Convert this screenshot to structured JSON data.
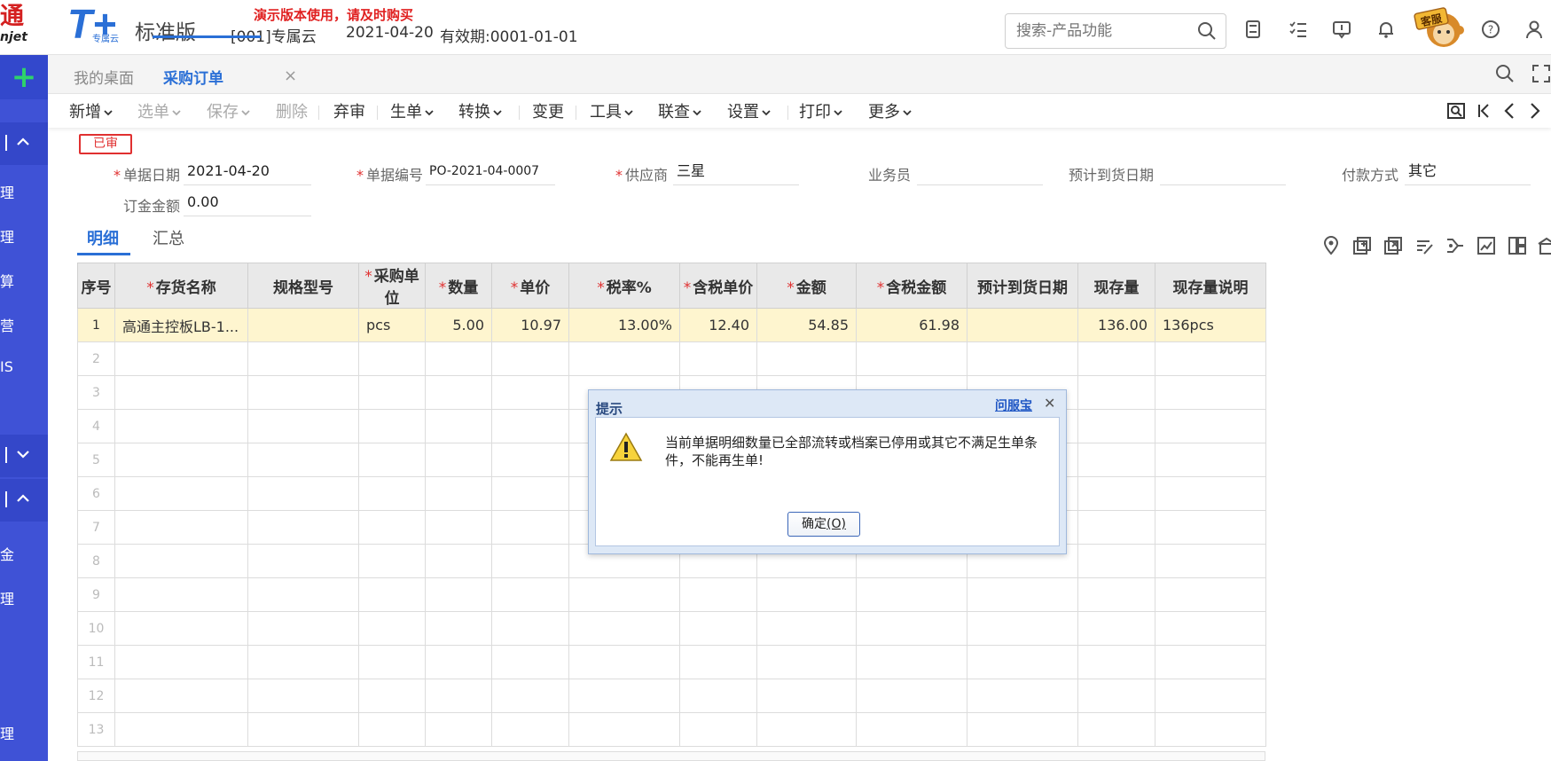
{
  "header": {
    "brand_left_line1": "通",
    "brand_left_line2": "njet",
    "logo_text": "T+",
    "logo_sub": "专属云",
    "edition": "标准版",
    "demo_notice": "演示版本使用，请及时购买",
    "account": "[001]专属云",
    "system_date": "2021-04-20",
    "validity": "有效期:0001-01-01",
    "search_placeholder": "搜索-产品功能",
    "kefu_label": "客服"
  },
  "sidebar": {
    "add_label": "+",
    "items": [
      "理",
      "理",
      "算",
      "营",
      "IS",
      "金",
      "理",
      "理"
    ]
  },
  "tabs": [
    {
      "label": "我的桌面",
      "active": false
    },
    {
      "label": "采购订单",
      "active": true
    }
  ],
  "toolbar": {
    "buttons": [
      {
        "label": "新增",
        "dropdown": true,
        "disabled": false
      },
      {
        "label": "选单",
        "dropdown": true,
        "disabled": true
      },
      {
        "label": "保存",
        "dropdown": true,
        "disabled": true
      },
      {
        "label": "删除",
        "dropdown": false,
        "disabled": true
      },
      {
        "label": "弃审",
        "dropdown": false,
        "disabled": false
      },
      {
        "label": "生单",
        "dropdown": true,
        "disabled": false
      },
      {
        "label": "转换",
        "dropdown": true,
        "disabled": false
      },
      {
        "label": "变更",
        "dropdown": false,
        "disabled": false
      },
      {
        "label": "工具",
        "dropdown": true,
        "disabled": false
      },
      {
        "label": "联查",
        "dropdown": true,
        "disabled": false
      },
      {
        "label": "设置",
        "dropdown": true,
        "disabled": false
      },
      {
        "label": "打印",
        "dropdown": true,
        "disabled": false
      },
      {
        "label": "更多",
        "dropdown": true,
        "disabled": false
      }
    ]
  },
  "status": "已审",
  "form": {
    "doc_date_label": "单据日期",
    "doc_date": "2021-04-20",
    "doc_no_label": "单据编号",
    "doc_no": "PO-2021-04-0007",
    "supplier_label": "供应商",
    "supplier": "三星",
    "salesman_label": "业务员",
    "salesman": "",
    "eta_label": "预计到货日期",
    "eta": "",
    "payment_label": "付款方式",
    "payment": "其它",
    "amount_label": "订金金额",
    "amount": "0.00"
  },
  "detail_tabs": [
    "明细",
    "汇总"
  ],
  "grid": {
    "headers": [
      "序号",
      "存货名称",
      "规格型号",
      "采购单位",
      "数量",
      "单价",
      "税率%",
      "含税单价",
      "金额",
      "含税金额",
      "预计到货日期",
      "现存量",
      "现存量说明"
    ],
    "rows": [
      [
        "1",
        "高通主控板LB-1...",
        "",
        "pcs",
        "5.00",
        "10.97",
        "13.00%",
        "12.40",
        "54.85",
        "61.98",
        "",
        "136.00",
        "136pcs"
      ]
    ],
    "empty_rows": [
      "2",
      "3",
      "4",
      "5",
      "6",
      "7",
      "8",
      "9",
      "10",
      "11",
      "12",
      "13"
    ]
  },
  "dialog": {
    "title": "提示",
    "help_link": "问服宝",
    "close": "✕",
    "message": "当前单据明细数量已全部流转或档案已停用或其它不满足生单条件，不能再生单!",
    "ok_label": "确定",
    "ok_hotkey": "(O)"
  }
}
